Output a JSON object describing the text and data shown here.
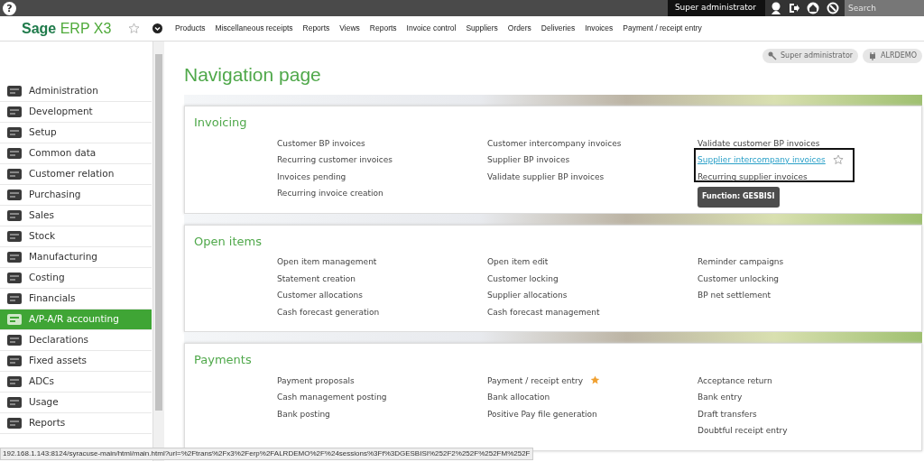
{
  "top_bar": {
    "help": "?",
    "user": "Super administrator",
    "search": {
      "placeholder": "Search"
    }
  },
  "navbar": {
    "logo_bold": "Sage",
    "logo_rest": "ERP X3",
    "links": [
      "Products",
      "Miscellaneous receipts",
      "Reports",
      "Views",
      "Reports",
      "Invoice control",
      "Suppliers",
      "Orders",
      "Deliveries",
      "Invoices",
      "Payment / receipt entry"
    ]
  },
  "badges": [
    {
      "kind": "role",
      "label": "Super administrator"
    },
    {
      "kind": "folder",
      "label": "ALRDEMO"
    }
  ],
  "sidebar": {
    "items": [
      {
        "label": "Administration",
        "selected": false
      },
      {
        "label": "Development",
        "selected": false
      },
      {
        "label": "Setup",
        "selected": false
      },
      {
        "label": "Common data",
        "selected": false
      },
      {
        "label": "Customer relation",
        "selected": false
      },
      {
        "label": "Purchasing",
        "selected": false
      },
      {
        "label": "Sales",
        "selected": false
      },
      {
        "label": "Stock",
        "selected": false
      },
      {
        "label": "Manufacturing",
        "selected": false
      },
      {
        "label": "Costing",
        "selected": false
      },
      {
        "label": "Financials",
        "selected": false
      },
      {
        "label": "A/P-A/R accounting",
        "selected": true
      },
      {
        "label": "Declarations",
        "selected": false
      },
      {
        "label": "Fixed assets",
        "selected": false
      },
      {
        "label": "ADCs",
        "selected": false
      },
      {
        "label": "Usage",
        "selected": false
      },
      {
        "label": "Reports",
        "selected": false
      }
    ]
  },
  "page_title": "Navigation page",
  "sections": [
    {
      "title": "Invoicing",
      "columns": [
        [
          {
            "label": "Customer BP invoices"
          },
          {
            "label": "Recurring customer invoices"
          },
          {
            "label": "Invoices pending"
          },
          {
            "label": "Recurring invoice creation"
          }
        ],
        [
          {
            "label": "Customer intercompany invoices"
          },
          {
            "label": "Supplier BP invoices"
          },
          {
            "label": "Validate supplier BP invoices"
          }
        ],
        [
          {
            "label": "Validate customer BP invoices"
          },
          {
            "label": "Supplier intercompany invoices",
            "hovered": true,
            "tooltip": "Function: GESBISI"
          },
          {
            "label": "Recurring supplier invoices"
          }
        ]
      ]
    },
    {
      "title": "Open items",
      "columns": [
        [
          {
            "label": "Open item management"
          },
          {
            "label": "Statement creation"
          },
          {
            "label": "Customer allocations"
          },
          {
            "label": "Cash forecast generation"
          }
        ],
        [
          {
            "label": "Open item edit"
          },
          {
            "label": "Customer locking"
          },
          {
            "label": "Supplier allocations"
          },
          {
            "label": "Cash forecast management"
          }
        ],
        [
          {
            "label": "Reminder campaigns"
          },
          {
            "label": "Customer unlocking"
          },
          {
            "label": "BP net settlement"
          }
        ]
      ]
    },
    {
      "title": "Payments",
      "columns": [
        [
          {
            "label": "Payment proposals"
          },
          {
            "label": "Cash management posting"
          },
          {
            "label": "Bank posting"
          }
        ],
        [
          {
            "label": "Payment / receipt entry",
            "favorite": true
          },
          {
            "label": "Bank allocation"
          },
          {
            "label": "Positive Pay file generation"
          }
        ],
        [
          {
            "label": "Acceptance return"
          },
          {
            "label": "Bank entry"
          },
          {
            "label": "Draft transfers"
          },
          {
            "label": "Doubtful receipt entry"
          }
        ]
      ]
    }
  ],
  "status_bar": "192.168.1.143:8124/syracuse-main/html/main.html?url=%2Ftrans%2Fx3%2Ferp%2FALRDEMO%2F%24sessions%3Ff%3DGESBISI%252F2%252F%252FM%252F"
}
